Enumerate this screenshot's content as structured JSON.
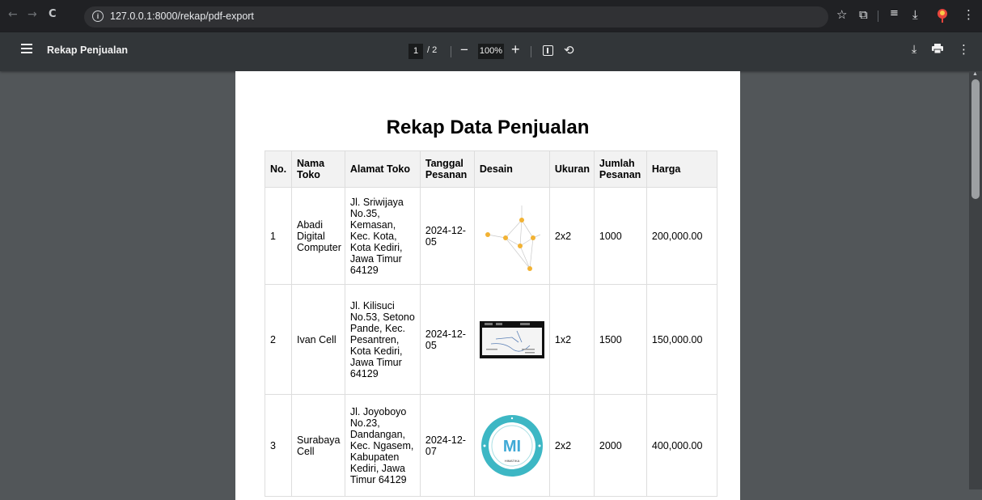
{
  "browser": {
    "url": "127.0.0.1:8000/rekap/pdf-export",
    "nav_back": "←",
    "nav_forward": "→",
    "nav_reload": "C"
  },
  "pdf_toolbar": {
    "title": "Rekap Penjualan",
    "current_page": "1",
    "total_pages": "/ 2",
    "zoom": "100%"
  },
  "document": {
    "heading": "Rekap Data Penjualan",
    "columns": [
      "No.",
      "Nama Toko",
      "Alamat Toko",
      "Tanggal Pesanan",
      "Desain",
      "Ukuran",
      "Jumlah Pesanan",
      "Harga"
    ],
    "rows": [
      {
        "no": "1",
        "nama_toko": "Abadi Digital Computer",
        "alamat": "Jl. Sriwijaya No.35, Kemasan, Kec. Kota, Kota Kediri, Jawa Timur 64129",
        "tanggal": "2024-12-05",
        "desain": "network-diagram-image",
        "ukuran": "2x2",
        "jumlah": "1000",
        "harga": "200,000.00"
      },
      {
        "no": "2",
        "nama_toko": "Ivan Cell",
        "alamat": "Jl. Kilisuci No.53, Setono Pande, Kec. Pesantren, Kota Kediri, Jawa Timur 64129",
        "tanggal": "2024-12-05",
        "desain": "screenshot-image",
        "ukuran": "1x2",
        "jumlah": "1500",
        "harga": "150,000.00"
      },
      {
        "no": "3",
        "nama_toko": "Surabaya Cell",
        "alamat": "Jl. Joyoboyo No.23, Dandangan, Kec. Ngasem, Kabupaten Kediri, Jawa Timur 64129",
        "tanggal": "2024-12-07",
        "desain": "logo-badge-image",
        "ukuran": "2x2",
        "jumlah": "2000",
        "harga": "400,000.00"
      }
    ]
  },
  "logo_text": {
    "badge_letters": "MI",
    "badge_caption": "HIMATIKA"
  },
  "colors": {
    "browser_bar": "#202124",
    "pdf_toolbar": "#323639",
    "viewer_bg": "#525659",
    "table_header": "#f2f2f2",
    "badge_teal": "#3db7c4"
  }
}
